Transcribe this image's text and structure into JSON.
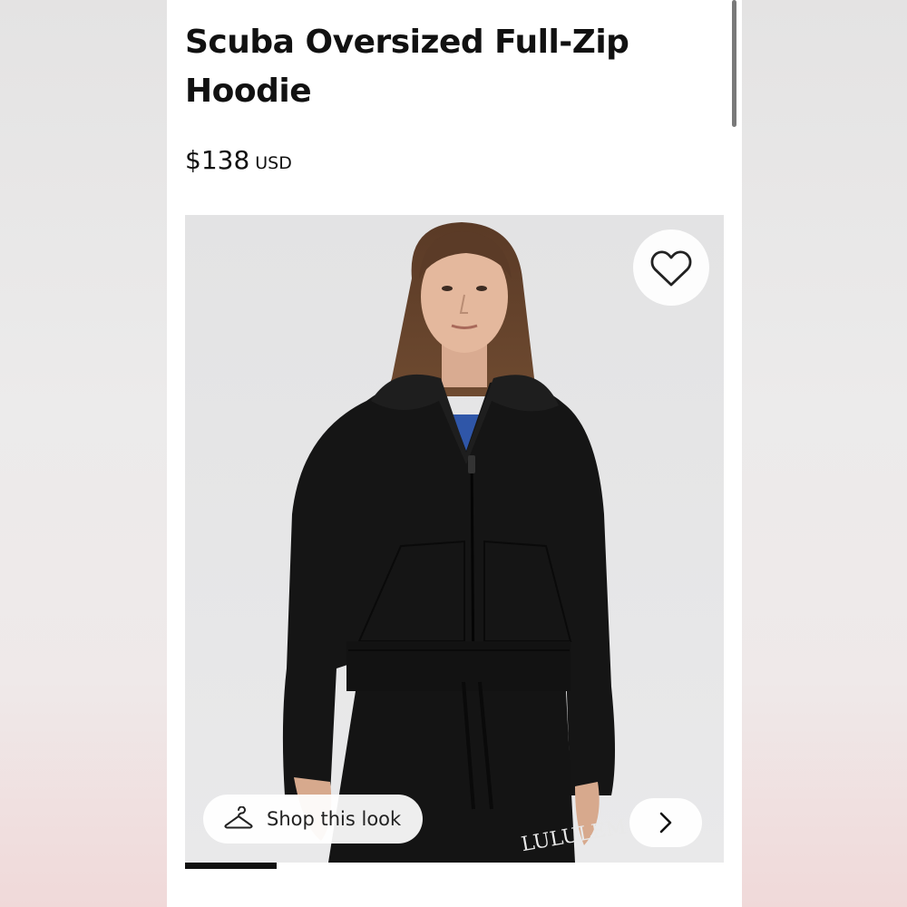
{
  "product": {
    "title": "Scuba Oversized Full-Zip Hoodie",
    "price": "$138",
    "currency": "USD"
  },
  "gallery": {
    "image_alt": "Woman wearing black Scuba Oversized Full-Zip Hoodie with black joggers",
    "wishlist_icon": "heart-icon",
    "shop_look_label": "Shop this look",
    "shop_look_icon": "hanger-icon",
    "next_icon": "chevron-right-icon",
    "progress": 0.17,
    "pants_text": "LULULEM"
  },
  "colors": {
    "text": "#111111",
    "hoodie": "#111111",
    "background": "#ffffff"
  }
}
